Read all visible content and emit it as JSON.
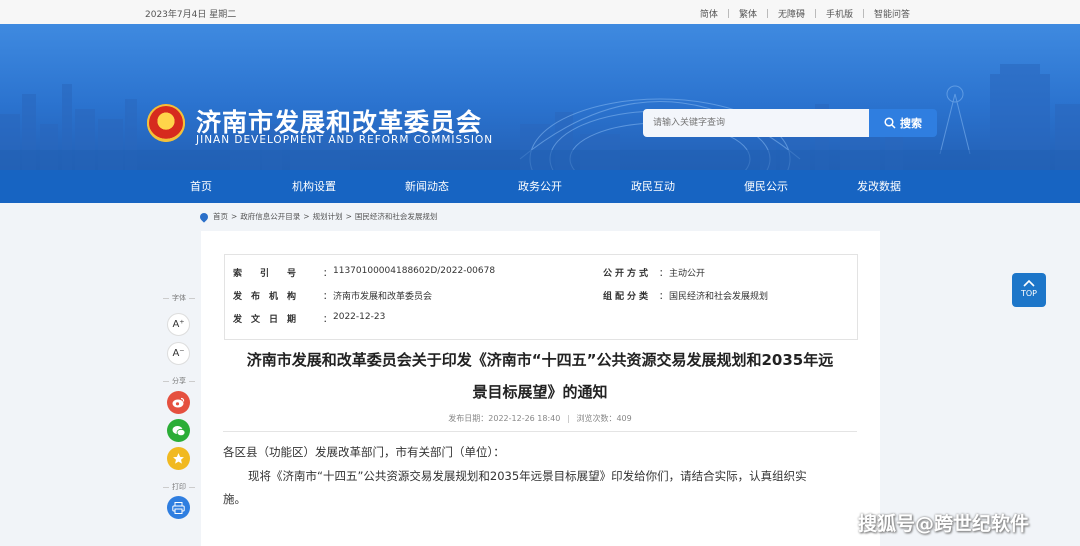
{
  "topbar": {
    "date": "2023年7月4日 星期二",
    "links": [
      "简体",
      "繁体",
      "无障碍",
      "手机版",
      "智能问答"
    ]
  },
  "header": {
    "title": "济南市发展和改革委员会",
    "subtitle": "JINAN DEVELOPMENT AND REFORM COMMISSION",
    "search_placeholder": "请输入关键字查询",
    "search_button": "搜索"
  },
  "nav": [
    "首页",
    "机构设置",
    "新闻动态",
    "政务公开",
    "政民互动",
    "便民公示",
    "发改数据"
  ],
  "breadcrumb": [
    "首页",
    ">",
    "政府信息公开目录",
    ">",
    "规划计划",
    ">",
    "国民经济和社会发展规划"
  ],
  "meta": {
    "index_label": "索　　引　　号",
    "index_value": "11370100004188602D/2022-00678",
    "org_label": "发　布　机　构",
    "org_value": "济南市发展和改革委员会",
    "date_label": "发　文　日　期",
    "date_value": "2022-12-23",
    "mode_label": "公开方式",
    "mode_value": "主动公开",
    "category_label": "组配分类",
    "category_value": "国民经济和社会发展规划",
    "colon": "："
  },
  "document": {
    "title_line1": "济南市发展和改革委员会关于印发《济南市“十四五”公共资源交易发展规划和2035年远",
    "title_line2": "景目标展望》的通知",
    "publish_date": "发布日期：2022-12-26 18:40",
    "views": "浏览次数：409",
    "salutation": "各区县（功能区）发展改革部门，市有关部门（单位）：",
    "body_line1": "现将《济南市“十四五”公共资源交易发展规划和2035年远景目标展望》印发给你们，请结合实际，认真组织实",
    "body_line2": "施。"
  },
  "side_tools": {
    "font_label": "字体",
    "font_increase": "A⁺",
    "font_decrease": "A⁻",
    "share_label": "分享",
    "print_label": "打印"
  },
  "back_to_top": "TOP",
  "watermark": "搜狐号@跨世纪软件",
  "colors": {
    "nav_blue": "#1764c2",
    "weibo": "#e5503f",
    "wechat": "#2bad37",
    "favorite": "#f1b921",
    "print": "#2f7ee0"
  }
}
